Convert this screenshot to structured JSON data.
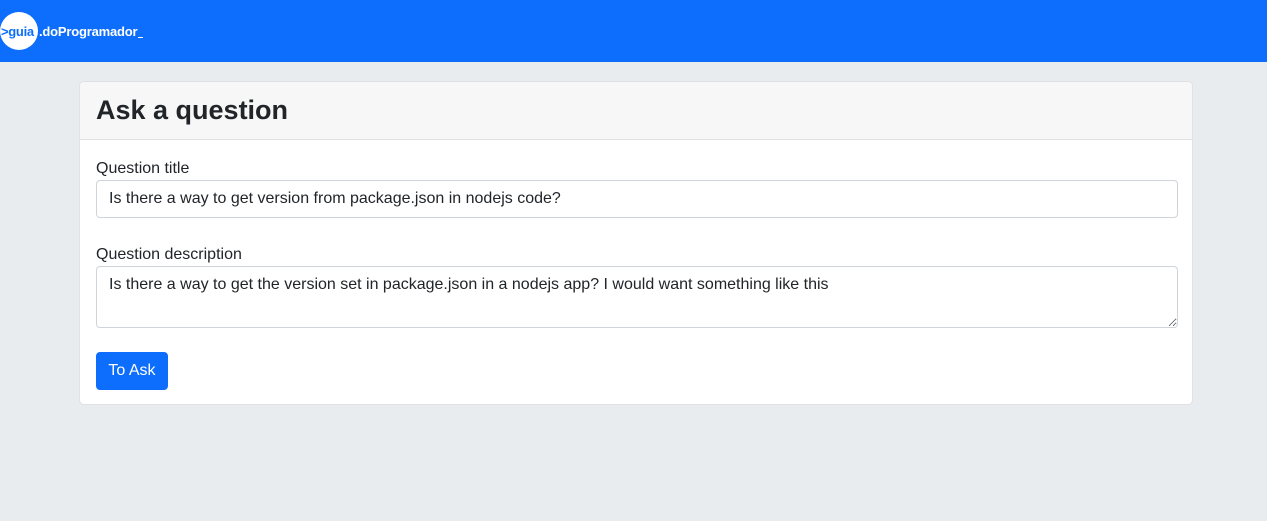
{
  "navbar": {
    "brand": {
      "circle_text": ">guia",
      "text": ".doProgramador"
    },
    "colors": {
      "primary": "#0d6efd",
      "background": "#e9ecef"
    }
  },
  "card": {
    "title": "Ask a question",
    "fields": {
      "question_title_label": "Question title",
      "question_title_value": "Is there a way to get version from package.json in nodejs code?",
      "question_description_label": "Question description",
      "question_description_value": "Is there a way to get the version set in package.json in a nodejs app? I would want something like this"
    },
    "submit_label": "To Ask"
  }
}
